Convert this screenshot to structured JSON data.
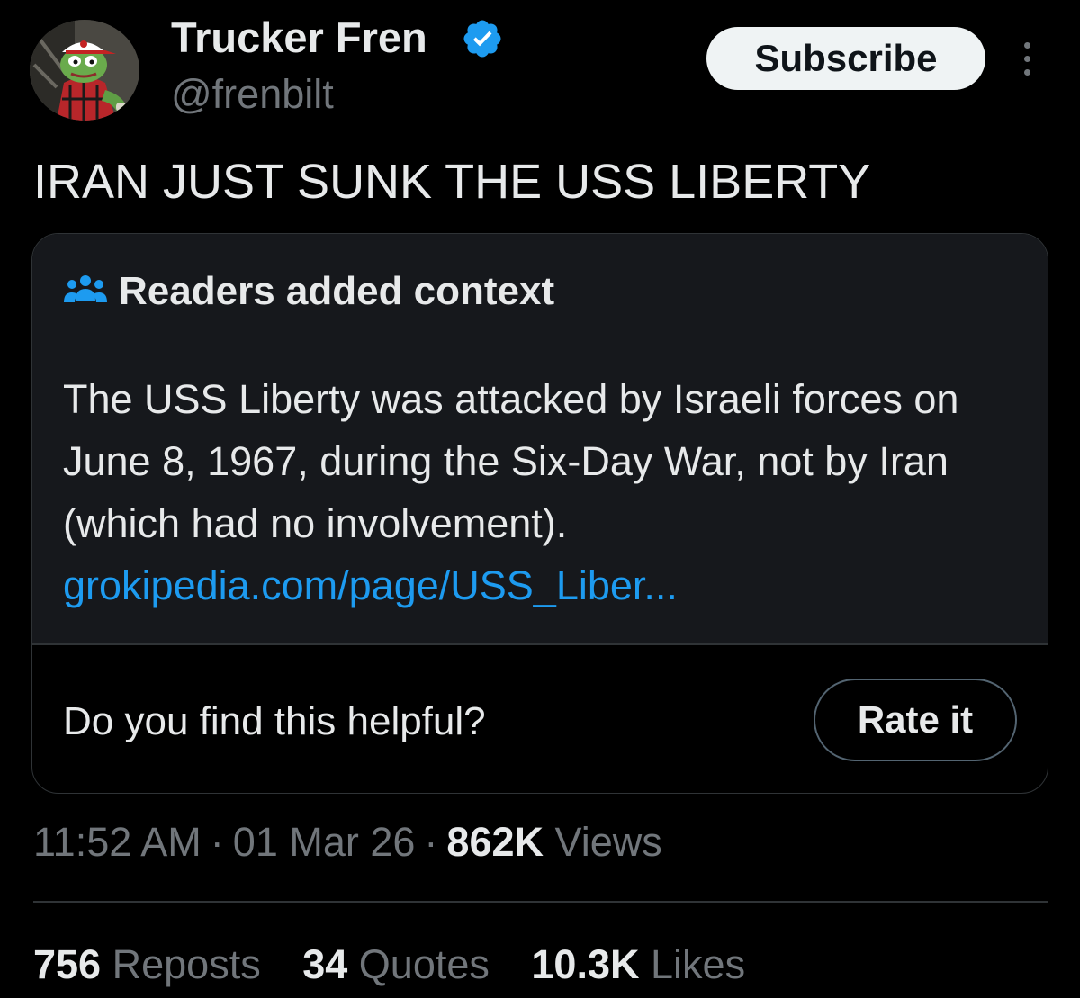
{
  "author": {
    "display_name": "Trucker Fren",
    "handle": "@frenbilt",
    "verified": true,
    "avatar_icon": "frog-trucker-avatar"
  },
  "header": {
    "subscribe_label": "Subscribe",
    "more_icon": "more-vertical-icon"
  },
  "tweet": {
    "text": "IRAN JUST SUNK THE USS LIBERTY"
  },
  "community_note": {
    "icon": "people-icon",
    "title": "Readers added context",
    "text": "The USS Liberty was attacked by Israeli forces on June 8, 1967, during the Six-Day War, not by Iran (which had no involvement).",
    "link": "grokipedia.com/page/USS_Liber...",
    "helpful_prompt": "Do you find this helpful?",
    "rate_label": "Rate it"
  },
  "meta": {
    "time": "11:52 AM",
    "date": "01 Mar 26",
    "views_count": "862K",
    "views_label": "Views",
    "separator": "·"
  },
  "stats": {
    "reposts_count": "756",
    "reposts_label": "Reposts",
    "quotes_count": "34",
    "quotes_label": "Quotes",
    "likes_count": "10.3K",
    "likes_label": "Likes"
  },
  "colors": {
    "background": "#000000",
    "text_primary": "#e7e9ea",
    "text_secondary": "#71767b",
    "link": "#1d9bf0",
    "verified": "#1d9bf0",
    "note_background": "#16181c",
    "border": "#2f3336"
  }
}
